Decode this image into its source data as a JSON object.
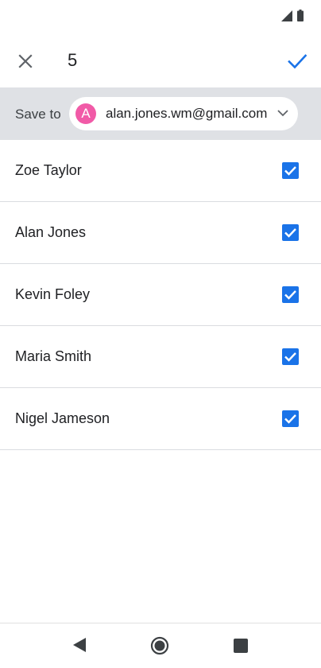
{
  "app_bar": {
    "count": "5",
    "close_icon": "close-icon",
    "confirm_icon": "check-icon"
  },
  "save_bar": {
    "label": "Save to",
    "account": {
      "avatar_letter": "A",
      "avatar_color": "#f15aa7",
      "email": "alan.jones.wm@gmail.com"
    }
  },
  "contacts": [
    {
      "name": "Zoe Taylor",
      "checked": true
    },
    {
      "name": "Alan Jones",
      "checked": true
    },
    {
      "name": "Kevin Foley",
      "checked": true
    },
    {
      "name": "Maria Smith",
      "checked": true
    },
    {
      "name": "Nigel Jameson",
      "checked": true
    }
  ],
  "colors": {
    "accent": "#1a73e8",
    "header_band": "#dfe1e5",
    "divider": "#dadce0"
  }
}
